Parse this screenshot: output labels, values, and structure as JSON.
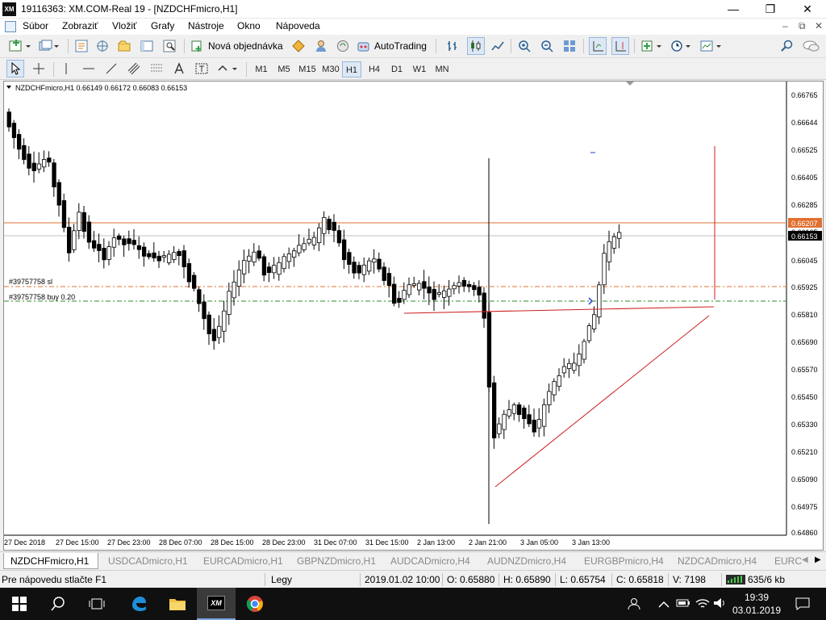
{
  "window": {
    "title": "19116363: XM.COM-Real 19 - [NZDCHFmicro,H1]",
    "logo": "XM",
    "minimize_icon": "—",
    "maximize_icon": "❐",
    "close_icon": "✕"
  },
  "menu": {
    "items": [
      "Súbor",
      "Zobraziť",
      "Vložiť",
      "Grafy",
      "Nástroje",
      "Okno",
      "Nápoveda"
    ],
    "mdi": [
      "–",
      "⧉",
      "✕"
    ]
  },
  "toolbar": {
    "new_order_label": "Nová objednávka",
    "autotrading_label": "AutoTrading"
  },
  "timeframes": [
    "M1",
    "M5",
    "M15",
    "M30",
    "H1",
    "H4",
    "D1",
    "W1",
    "MN"
  ],
  "active_timeframe": "H1",
  "chart": {
    "header": "NZDCHFmicro,H1  0.66149 0.66172 0.66083 0.66153",
    "sl_label": "#39757758 sl",
    "buy_label": "#39757758 buy 0.20",
    "price_labels": [
      "0.66765",
      "0.66644",
      "0.66525",
      "0.66405",
      "0.66285",
      "0.66165",
      "0.66045",
      "0.65925",
      "0.65810",
      "0.65690",
      "0.65570",
      "0.65450",
      "0.65330",
      "0.65210",
      "0.65090",
      "0.64975",
      "0.64860"
    ],
    "current_price_tag": "0.66153",
    "resistance_tag": "0.66207",
    "time_labels": [
      "27 Dec 2018",
      "27 Dec 15:00",
      "27 Dec 23:00",
      "28 Dec 07:00",
      "28 Dec 15:00",
      "28 Dec 23:00",
      "31 Dec 07:00",
      "31 Dec 15:00",
      "2 Jan 13:00",
      "2 Jan 21:00",
      "3 Jan 05:00",
      "3 Jan 13:00"
    ],
    "colors": {
      "bull": "#ffffff",
      "bear": "#000000",
      "resistance": "#e07030",
      "sl_line": "#e07030",
      "buy_line": "#2e8b2e",
      "trendline": "#cc1f1f",
      "current": "#c0c0c0"
    }
  },
  "tabs": [
    "NZDCHFmicro,H1",
    "USDCADmicro,H1",
    "EURCADmicro,H1",
    "GBPNZDmicro,H1",
    "AUDCADmicro,H4",
    "AUDNZDmicro,H4",
    "EURGBPmicro,H4",
    "NZDCADmicro,H4",
    "EURC"
  ],
  "active_tab": "NZDCHFmicro,H1",
  "status": {
    "help": "Pre nápovedu stlačte F1",
    "profile": "Legy",
    "datetime": "2019.01.02 10:00",
    "open": "O: 0.65880",
    "high": "H: 0.65890",
    "low": "L: 0.65754",
    "close": "C: 0.65818",
    "volume": "V: 7198",
    "traffic": "635/6 kb"
  },
  "taskbar": {
    "time": "19:39",
    "date": "03.01.2019",
    "xm_label": "XM"
  }
}
